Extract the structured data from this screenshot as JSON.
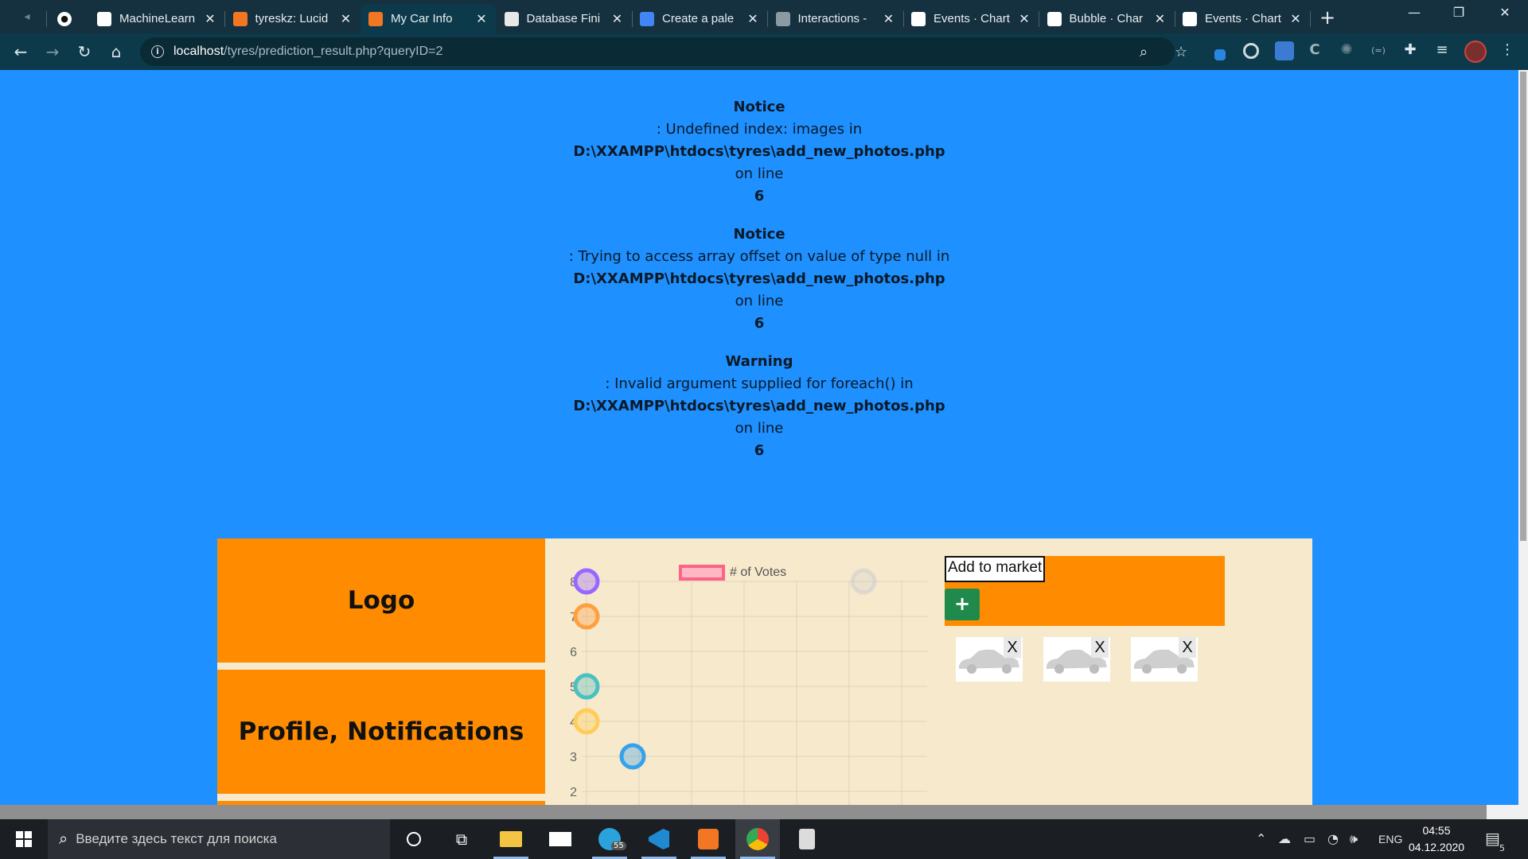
{
  "browser": {
    "tabs": [
      {
        "label": "MachineLearn",
        "icon": "github-icon"
      },
      {
        "label": "tyreskz: Lucid",
        "icon": "lucid-icon"
      },
      {
        "label": "My Car Info",
        "icon": "xampp-icon",
        "active": true
      },
      {
        "label": "Database Fini",
        "icon": "jetbrains-icon"
      },
      {
        "label": "Create a pale",
        "icon": "google-icon"
      },
      {
        "label": "Interactions -",
        "icon": "globe-icon"
      },
      {
        "label": "Events · Chart",
        "icon": "chartjs-icon"
      },
      {
        "label": "Bubble · Char",
        "icon": "chartjs-icon"
      },
      {
        "label": "Events · Chart",
        "icon": "chartjs-icon"
      }
    ],
    "close_glyph": "✕",
    "new_tab": "+",
    "url_host": "localhost",
    "url_path": "/tyres/prediction_result.php?queryID=2"
  },
  "errors": [
    {
      "type": "Notice",
      "message": ": Undefined index: images in",
      "file": "D:\\XXAMPP\\htdocs\\tyres\\add_new_photos.php",
      "on_line": "on line",
      "line": "6"
    },
    {
      "type": "Notice",
      "message": ": Trying to access array offset on value of type null in",
      "file": "D:\\XXAMPP\\htdocs\\tyres\\add_new_photos.php",
      "on_line": "on line",
      "line": "6"
    },
    {
      "type": "Warning",
      "message": ": Invalid argument supplied for foreach() in",
      "file": "D:\\XXAMPP\\htdocs\\tyres\\add_new_photos.php",
      "on_line": "on line",
      "line": "6"
    }
  ],
  "sidebar": {
    "logo": "Logo",
    "profile": "Profile, Notifications"
  },
  "chart_data": {
    "type": "scatter",
    "legend": [
      "# of Votes"
    ],
    "ytick_labels": [
      "8",
      "7",
      "6",
      "5",
      "4",
      "3",
      "2"
    ],
    "series": [
      {
        "name": "# of Votes",
        "points": [
          {
            "x": 0,
            "y": 8,
            "color": "#9966ff"
          },
          {
            "x": 0,
            "y": 7,
            "color": "#ff9f40"
          },
          {
            "x": 0,
            "y": 5,
            "color": "#4bc0c0"
          },
          {
            "x": 0,
            "y": 4,
            "color": "#ffcd56"
          },
          {
            "x": 1,
            "y": 3,
            "color": "#36a2eb"
          },
          {
            "x": 6,
            "y": 8,
            "color": "#c9cbcf"
          }
        ]
      }
    ],
    "ylim": [
      2,
      8
    ],
    "xlim": [
      0,
      6
    ],
    "grid": true
  },
  "market": {
    "input_value": "Add to market",
    "add_label": "+",
    "remove_label": "X",
    "photos": [
      {
        "alt": "car-photo"
      },
      {
        "alt": "car-photo"
      },
      {
        "alt": "car-photo"
      }
    ]
  },
  "taskbar": {
    "search_placeholder": "Введите здесь текст для поиска",
    "telegram_badge": "55",
    "language": "ENG",
    "time": "04:55",
    "date": "04.12.2020",
    "notifications": "5"
  }
}
